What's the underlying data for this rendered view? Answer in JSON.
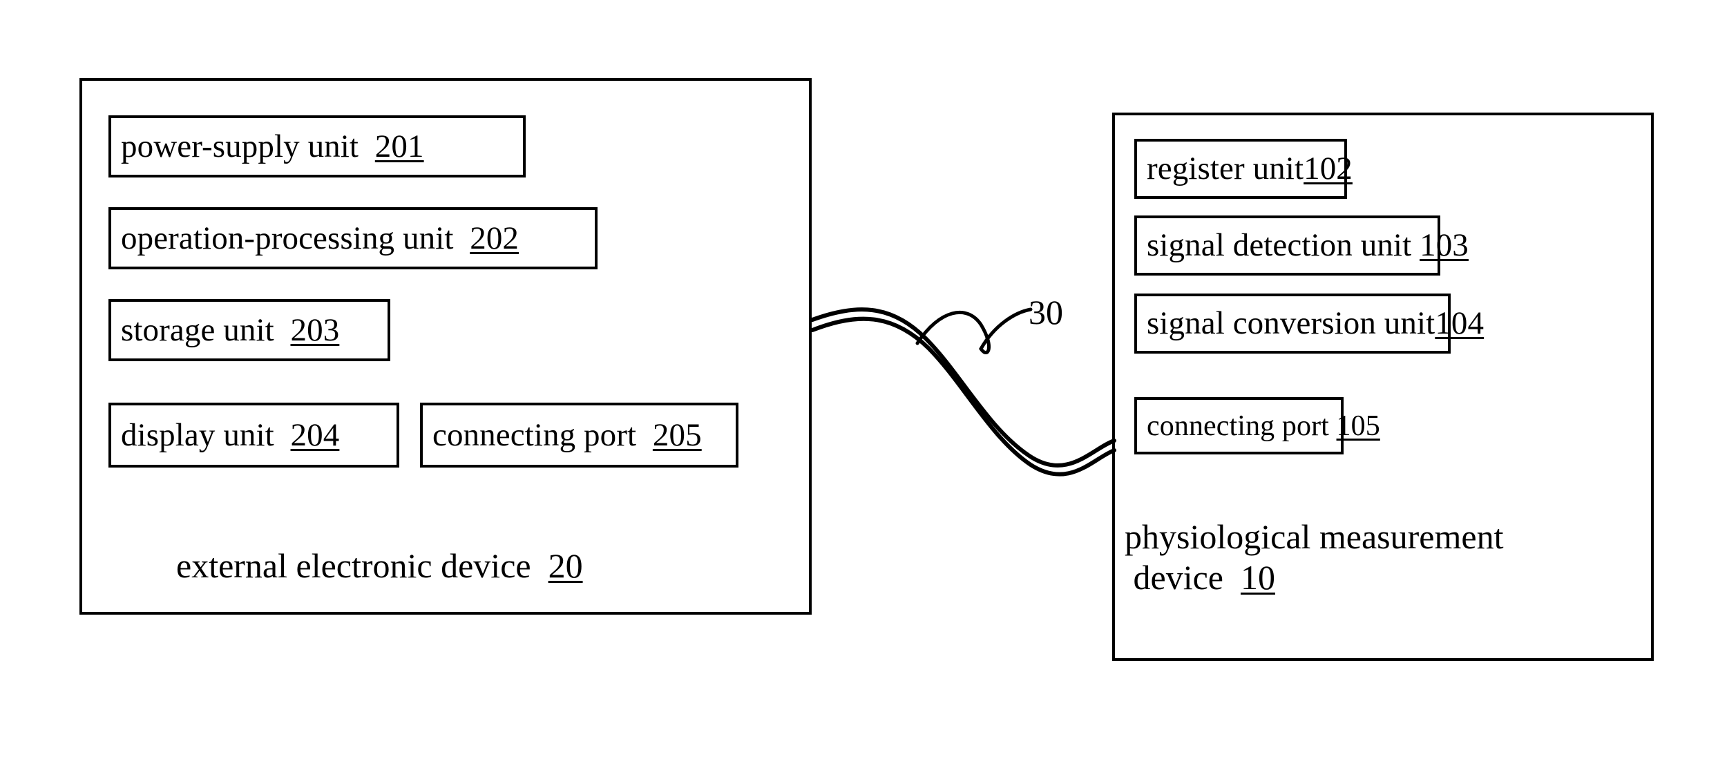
{
  "figure": {
    "type": "patent-block-diagram",
    "background_color": "#ffffff",
    "line_color": "#000000"
  },
  "external_device": {
    "caption_text": "external electronic device",
    "caption_ref": "20",
    "units": [
      {
        "name": "power-supply-unit",
        "label": "power-supply unit",
        "ref": "201"
      },
      {
        "name": "operation-processing-unit",
        "label": "operation-processing unit",
        "ref": "202"
      },
      {
        "name": "storage-unit",
        "label": "storage unit",
        "ref": "203"
      },
      {
        "name": "display-unit",
        "label": "display unit",
        "ref": "204"
      },
      {
        "name": "connecting-port",
        "label": "connecting port",
        "ref": "205"
      }
    ]
  },
  "measurement_device": {
    "caption_line1": "physiological measurement",
    "caption_line2": "device",
    "caption_ref": "10",
    "units": [
      {
        "name": "register-unit",
        "label": "register unit",
        "ref": "102"
      },
      {
        "name": "signal-detection-unit",
        "label": "signal detection unit",
        "ref": "103"
      },
      {
        "name": "signal-conversion-unit",
        "label": "signal conversion unit",
        "ref": "104"
      },
      {
        "name": "connecting-port",
        "label": "connecting port",
        "ref": "105"
      }
    ]
  },
  "cable": {
    "ref": "30",
    "name": "connection-cable"
  }
}
